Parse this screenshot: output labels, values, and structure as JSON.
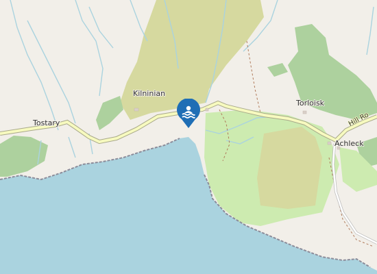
{
  "map": {
    "places": [
      {
        "id": "tostary",
        "label": "Tostary"
      },
      {
        "id": "kilninian",
        "label": "Kilninian"
      },
      {
        "id": "torloisk",
        "label": "Torloisk"
      },
      {
        "id": "achleck",
        "label": "Achleck"
      }
    ],
    "road_label": "Hill Ro",
    "marker": {
      "icon": "swimming-icon",
      "color": "#1f6eb5"
    },
    "colors": {
      "land": "#f2efe9",
      "water": "#aad3df",
      "woodland": "#add19e",
      "heath": "#d6d99f",
      "grass": "#cdebb0",
      "road": "#f7fabf",
      "stream": "#aad3df"
    }
  }
}
